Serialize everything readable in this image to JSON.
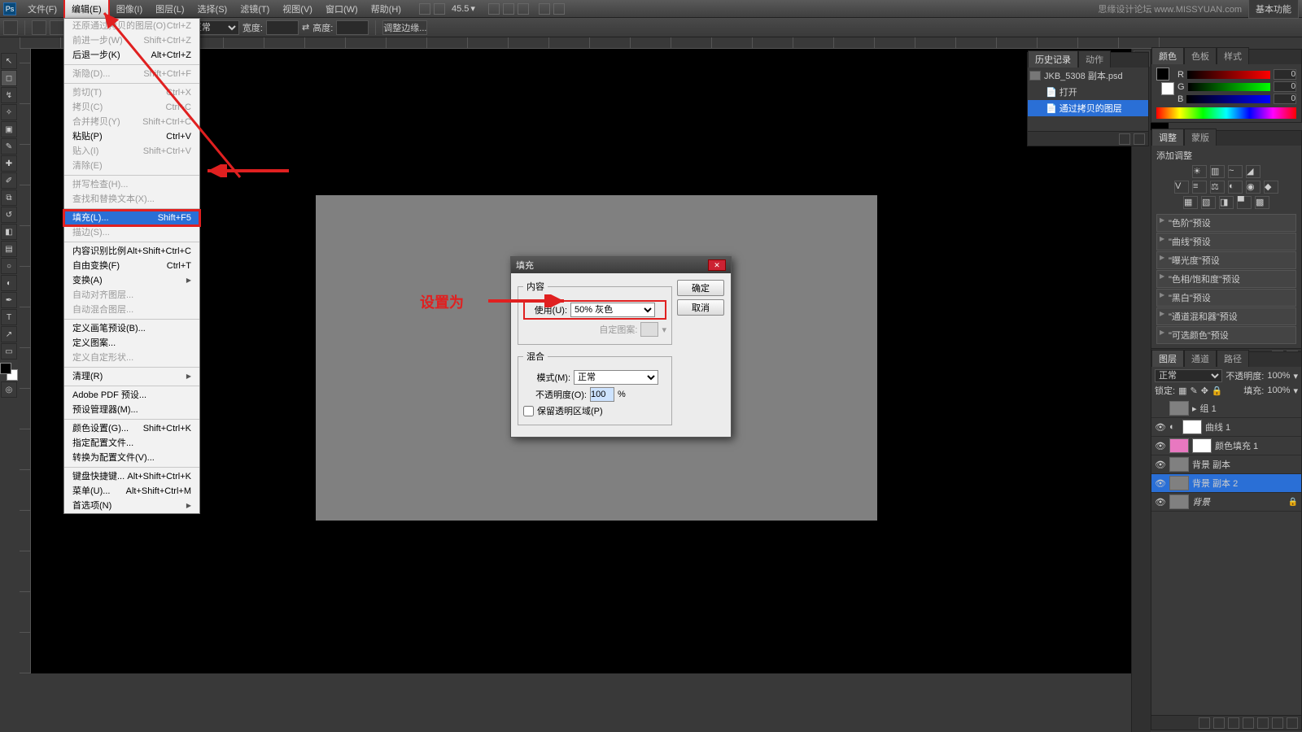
{
  "menubar": {
    "items": [
      "文件(F)",
      "编辑(E)",
      "图像(I)",
      "图层(L)",
      "选择(S)",
      "滤镜(T)",
      "视图(V)",
      "窗口(W)",
      "帮助(H)"
    ],
    "active_index": 1,
    "zoom": "45.5",
    "right_text": "思缘设计论坛  www.MISSYUAN.com",
    "right_button": "基本功能"
  },
  "optbar": {
    "mode": "正常",
    "adjust_edge": "调整边缘...",
    "width_lbl": "宽度:",
    "height_lbl": "高度:"
  },
  "edit_menu": {
    "rows": [
      {
        "l": "还原通过拷贝的图层(O)",
        "r": "Ctrl+Z",
        "dis": true
      },
      {
        "l": "前进一步(W)",
        "r": "Shift+Ctrl+Z",
        "dis": true
      },
      {
        "l": "后退一步(K)",
        "r": "Alt+Ctrl+Z"
      },
      {
        "sep": true
      },
      {
        "l": "渐隐(D)...",
        "r": "Shift+Ctrl+F",
        "dis": true
      },
      {
        "sep": true
      },
      {
        "l": "剪切(T)",
        "r": "Ctrl+X",
        "dis": true
      },
      {
        "l": "拷贝(C)",
        "r": "Ctrl+C",
        "dis": true
      },
      {
        "l": "合并拷贝(Y)",
        "r": "Shift+Ctrl+C",
        "dis": true
      },
      {
        "l": "粘贴(P)",
        "r": "Ctrl+V"
      },
      {
        "l": "贴入(I)",
        "r": "Shift+Ctrl+V",
        "dis": true
      },
      {
        "l": "清除(E)",
        "r": "",
        "dis": true
      },
      {
        "sep": true
      },
      {
        "l": "拼写检查(H)...",
        "r": "",
        "dis": true
      },
      {
        "l": "查找和替换文本(X)...",
        "r": "",
        "dis": true
      },
      {
        "sep": true
      },
      {
        "l": "填充(L)...",
        "r": "Shift+F5",
        "hl": true
      },
      {
        "l": "描边(S)...",
        "r": "",
        "dis": true
      },
      {
        "sep": true
      },
      {
        "l": "内容识别比例",
        "r": "Alt+Shift+Ctrl+C"
      },
      {
        "l": "自由变换(F)",
        "r": "Ctrl+T"
      },
      {
        "l": "变换(A)",
        "r": "",
        "sub": true
      },
      {
        "l": "自动对齐图层...",
        "r": "",
        "dis": true
      },
      {
        "l": "自动混合图层...",
        "r": "",
        "dis": true
      },
      {
        "sep": true
      },
      {
        "l": "定义画笔预设(B)...",
        "r": ""
      },
      {
        "l": "定义图案...",
        "r": ""
      },
      {
        "l": "定义自定形状...",
        "r": "",
        "dis": true
      },
      {
        "sep": true
      },
      {
        "l": "清理(R)",
        "r": "",
        "sub": true
      },
      {
        "sep": true
      },
      {
        "l": "Adobe PDF 预设...",
        "r": ""
      },
      {
        "l": "预设管理器(M)...",
        "r": ""
      },
      {
        "sep": true
      },
      {
        "l": "颜色设置(G)...",
        "r": "Shift+Ctrl+K"
      },
      {
        "l": "指定配置文件...",
        "r": ""
      },
      {
        "l": "转换为配置文件(V)...",
        "r": ""
      },
      {
        "sep": true
      },
      {
        "l": "键盘快捷键...",
        "r": "Alt+Shift+Ctrl+K"
      },
      {
        "l": "菜单(U)...",
        "r": "Alt+Shift+Ctrl+M"
      },
      {
        "l": "首选项(N)",
        "r": "",
        "sub": true
      }
    ]
  },
  "dialog": {
    "title": "填充",
    "ok": "确定",
    "cancel": "取消",
    "content_legend": "内容",
    "use_lbl": "使用(U):",
    "use_val": "50% 灰色",
    "pattern_lbl": "自定图案:",
    "blend_legend": "混合",
    "mode_lbl": "模式(M):",
    "mode_val": "正常",
    "opacity_lbl": "不透明度(O):",
    "opacity_val": "100",
    "pct": "%",
    "preserve_lbl": "保留透明区域(P)"
  },
  "annotation": {
    "label": "设置为"
  },
  "history": {
    "tabs": [
      "历史记录",
      "动作"
    ],
    "doc": "JKB_5308 副本.psd",
    "steps": [
      {
        "t": "打开"
      },
      {
        "t": "通过拷贝的图层",
        "sel": true
      }
    ]
  },
  "color": {
    "tabs": [
      "颜色",
      "色板",
      "样式"
    ],
    "r": "0",
    "g": "0",
    "b": "0"
  },
  "adjust": {
    "tabs": [
      "调整",
      "蒙版"
    ],
    "title": "添加调整",
    "presets": [
      "\"色阶\"预设",
      "\"曲线\"预设",
      "\"曝光度\"预设",
      "\"色相/饱和度\"预设",
      "\"黑白\"预设",
      "\"通道混和器\"预设",
      "\"可选颜色\"预设"
    ]
  },
  "layers": {
    "tabs": [
      "图层",
      "通道",
      "路径"
    ],
    "blend": "正常",
    "opacity_lbl": "不透明度:",
    "opacity": "100%",
    "fill_lbl": "填充:",
    "fill": "100%",
    "lock_lbl": "锁定:",
    "rows": [
      {
        "name": "组 1",
        "grp": true
      },
      {
        "name": "曲线 1",
        "adj": true,
        "vis": true
      },
      {
        "name": "颜色填充 1",
        "pink": true,
        "vis": true
      },
      {
        "name": "背景 副本",
        "vis": true
      },
      {
        "name": "背景 副本 2",
        "sel": true,
        "vis": true
      },
      {
        "name": "背景",
        "locked": true,
        "vis": true
      }
    ]
  }
}
